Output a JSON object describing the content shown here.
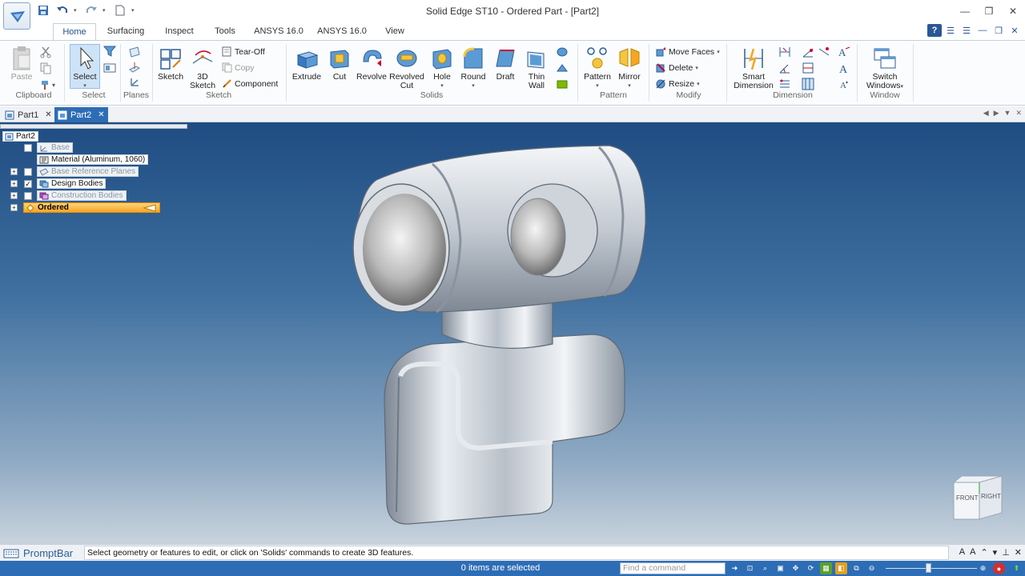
{
  "window": {
    "title": "Solid Edge ST10 - Ordered Part - [Part2]"
  },
  "quick_access": {
    "items": [
      "save-icon",
      "undo-icon",
      "redo-icon",
      "new-icon"
    ]
  },
  "ribbon_tabs": [
    "Home",
    "Surfacing",
    "Inspect",
    "Tools",
    "ANSYS 16.0",
    "ANSYS 16.0",
    "View"
  ],
  "ribbon": {
    "clipboard": {
      "paste": "Paste",
      "label": "Clipboard"
    },
    "select": {
      "select": "Select",
      "label": "Select"
    },
    "planes": {
      "label": "Planes"
    },
    "sketch": {
      "sketch": "Sketch",
      "sketch3d_line1": "3D",
      "sketch3d_line2": "Sketch",
      "tearoff": "Tear-Off",
      "copy": "Copy",
      "component": "Component",
      "label": "Sketch"
    },
    "solids": {
      "extrude": "Extrude",
      "cut": "Cut",
      "revolve": "Revolve",
      "revolved_cut_line1": "Revolved",
      "revolved_cut_line2": "Cut",
      "hole": "Hole",
      "round": "Round",
      "draft": "Draft",
      "thin_wall_line1": "Thin",
      "thin_wall_line2": "Wall",
      "label": "Solids"
    },
    "pattern": {
      "pattern": "Pattern",
      "mirror": "Mirror",
      "label": "Pattern"
    },
    "modify": {
      "move_faces": "Move Faces",
      "delete": "Delete",
      "resize": "Resize",
      "label": "Modify"
    },
    "dimension": {
      "smart_line1": "Smart",
      "smart_line2": "Dimension",
      "label": "Dimension"
    },
    "window": {
      "switch_line1": "Switch",
      "switch_line2": "Windows",
      "label": "Window"
    }
  },
  "doc_tabs": [
    {
      "label": "Part1",
      "active": false
    },
    {
      "label": "Part2",
      "active": true
    }
  ],
  "tree": {
    "root": "Part2",
    "items": [
      {
        "label": "Base",
        "checked": false,
        "dim": true
      },
      {
        "label": "Material (Aluminum, 1060)"
      },
      {
        "label": "Base Reference Planes",
        "checked": false,
        "dim": true
      },
      {
        "label": "Design Bodies",
        "checked": true,
        "dim": false
      },
      {
        "label": "Construction Bodies",
        "checked": false,
        "dim": true
      },
      {
        "label": "Ordered"
      }
    ]
  },
  "viewcube": {
    "front": "FRONT",
    "right": "RIGHT"
  },
  "promptbar": {
    "title": "PromptBar",
    "message": "Select geometry or features to edit, or click on 'Solids' commands to create 3D features."
  },
  "status": {
    "selection": "0 items are selected",
    "find_placeholder": "Find a command"
  },
  "colors": {
    "accent": "#2d6db5",
    "ordered_highlight": "#f5a623",
    "viewport_top": "#1f4c82",
    "viewport_bottom": "#c9d3dd"
  }
}
